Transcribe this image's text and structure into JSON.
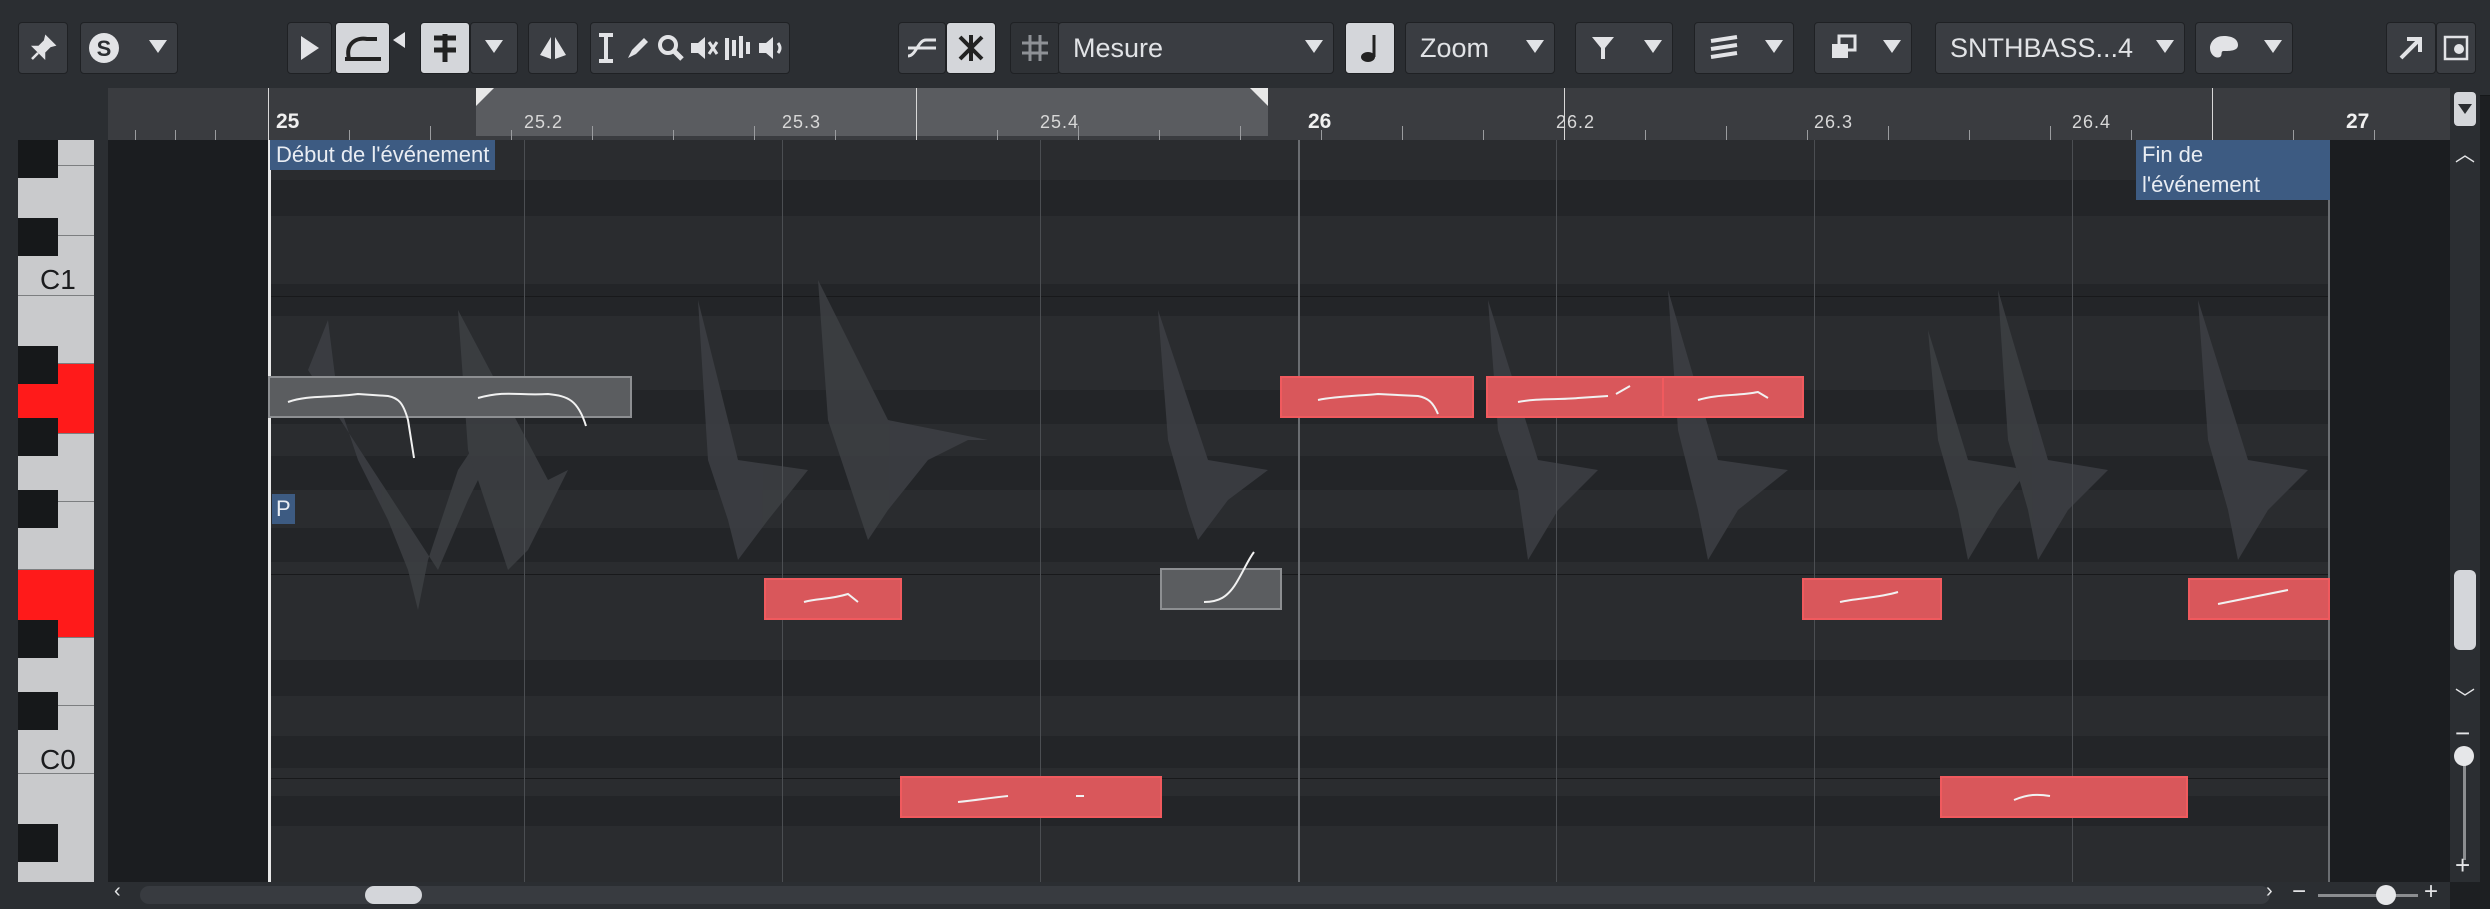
{
  "toolbar": {
    "quantize_label": "Mesure",
    "zoom_label": "Zoom",
    "track_label": "SNTHBASS...4"
  },
  "ruler": {
    "bars": [
      "25",
      "26",
      "27"
    ],
    "beats": [
      "25.2",
      "25.3",
      "25.4",
      "26.2",
      "26.3",
      "26.4"
    ]
  },
  "keyboard": {
    "labels": [
      "C1",
      "C0"
    ],
    "highlight_color": "#ff1a1a"
  },
  "events": {
    "start_label": "Début de l'événement",
    "end_label": "Fin de l'événement",
    "p_marker": "P"
  },
  "colors": {
    "note_fill": "#d9575b",
    "note_border": "#f05a5e",
    "ghost_note": "#5b5d60",
    "tag_bg": "#3d5b82"
  }
}
